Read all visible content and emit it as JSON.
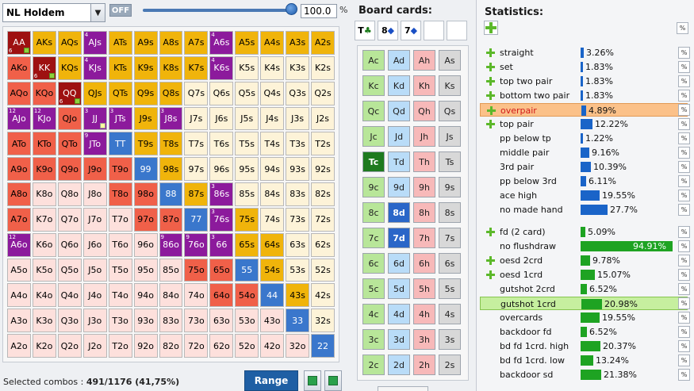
{
  "toolbar": {
    "game_select": "NL Holdem",
    "toggle_label": "OFF",
    "range_value": "100.0",
    "range_unit": "%"
  },
  "matrix": {
    "rows": [
      [
        "AA",
        "AKs",
        "AQs",
        "AJs",
        "ATs",
        "A9s",
        "A8s",
        "A7s",
        "A6s",
        "A5s",
        "A4s",
        "A3s",
        "A2s"
      ],
      [
        "AKo",
        "KK",
        "KQs",
        "KJs",
        "KTs",
        "K9s",
        "K8s",
        "K7s",
        "K6s",
        "K5s",
        "K4s",
        "K3s",
        "K2s"
      ],
      [
        "AQo",
        "KQo",
        "QQ",
        "QJs",
        "QTs",
        "Q9s",
        "Q8s",
        "Q7s",
        "Q6s",
        "Q5s",
        "Q4s",
        "Q3s",
        "Q2s"
      ],
      [
        "AJo",
        "KJo",
        "QJo",
        "JJ",
        "JTs",
        "J9s",
        "J8s",
        "J7s",
        "J6s",
        "J5s",
        "J4s",
        "J3s",
        "J2s"
      ],
      [
        "ATo",
        "KTo",
        "QTo",
        "JTo",
        "TT",
        "T9s",
        "T8s",
        "T7s",
        "T6s",
        "T5s",
        "T4s",
        "T3s",
        "T2s"
      ],
      [
        "A9o",
        "K9o",
        "Q9o",
        "J9o",
        "T9o",
        "99",
        "98s",
        "97s",
        "96s",
        "95s",
        "94s",
        "93s",
        "92s"
      ],
      [
        "A8o",
        "K8o",
        "Q8o",
        "J8o",
        "T8o",
        "98o",
        "88",
        "87s",
        "86s",
        "85s",
        "84s",
        "83s",
        "82s"
      ],
      [
        "A7o",
        "K7o",
        "Q7o",
        "J7o",
        "T7o",
        "97o",
        "87o",
        "77",
        "76s",
        "75s",
        "74s",
        "73s",
        "72s"
      ],
      [
        "A6o",
        "K6o",
        "Q6o",
        "J6o",
        "T6o",
        "96o",
        "86o",
        "76o",
        "66",
        "65s",
        "64s",
        "63s",
        "62s"
      ],
      [
        "A5o",
        "K5o",
        "Q5o",
        "J5o",
        "T5o",
        "95o",
        "85o",
        "75o",
        "65o",
        "55",
        "54s",
        "53s",
        "52s"
      ],
      [
        "A4o",
        "K4o",
        "Q4o",
        "J4o",
        "T4o",
        "94o",
        "84o",
        "74o",
        "64o",
        "54o",
        "44",
        "43s",
        "42s"
      ],
      [
        "A3o",
        "K3o",
        "Q3o",
        "J3o",
        "T3o",
        "93o",
        "83o",
        "73o",
        "63o",
        "53o",
        "43o",
        "33",
        "32s"
      ],
      [
        "A2o",
        "K2o",
        "Q2o",
        "J2o",
        "T2o",
        "92o",
        "82o",
        "72o",
        "62o",
        "52o",
        "42o",
        "32o",
        "22"
      ]
    ],
    "colors": [
      [
        "dr",
        "y",
        "y",
        "p",
        "y",
        "y",
        "y",
        "y",
        "p",
        "y",
        "y",
        "y",
        "y"
      ],
      [
        "r",
        "dr",
        "y",
        "p",
        "y",
        "y",
        "y",
        "y",
        "p",
        "l",
        "l",
        "l",
        "l"
      ],
      [
        "r",
        "r",
        "dr",
        "y",
        "y",
        "y",
        "y",
        "l",
        "l",
        "l",
        "l",
        "l",
        "l"
      ],
      [
        "p",
        "p",
        "r",
        "p",
        "p",
        "y",
        "p",
        "l",
        "l",
        "l",
        "l",
        "l",
        "l"
      ],
      [
        "r",
        "r",
        "r",
        "p",
        "b",
        "y",
        "y",
        "l",
        "l",
        "l",
        "l",
        "l",
        "l"
      ],
      [
        "r",
        "r",
        "r",
        "r",
        "r",
        "b",
        "y",
        "l",
        "l",
        "l",
        "l",
        "l",
        "l"
      ],
      [
        "r",
        "k",
        "k",
        "k",
        "r",
        "r",
        "b",
        "y",
        "p",
        "l",
        "l",
        "l",
        "l"
      ],
      [
        "r",
        "k",
        "k",
        "k",
        "k",
        "r",
        "r",
        "b",
        "p",
        "y",
        "l",
        "l",
        "l"
      ],
      [
        "p",
        "k",
        "k",
        "k",
        "k",
        "k",
        "p",
        "p",
        "p",
        "y",
        "y",
        "l",
        "l"
      ],
      [
        "k",
        "k",
        "k",
        "k",
        "k",
        "k",
        "k",
        "r",
        "r",
        "b",
        "y",
        "l",
        "l"
      ],
      [
        "k",
        "k",
        "k",
        "k",
        "k",
        "k",
        "k",
        "k",
        "r",
        "r",
        "b",
        "y",
        "l"
      ],
      [
        "k",
        "k",
        "k",
        "k",
        "k",
        "k",
        "k",
        "k",
        "k",
        "k",
        "k",
        "b",
        "l"
      ],
      [
        "k",
        "k",
        "k",
        "k",
        "k",
        "k",
        "k",
        "k",
        "k",
        "k",
        "k",
        "k",
        "b"
      ]
    ],
    "palette": {
      "dr": "#9e1111",
      "r": "#f06049",
      "y": "#f0b40b",
      "p": "#8c1a9c",
      "b": "#3a77cc",
      "l": "#fdf3d8",
      "k": "#fde0dc"
    },
    "badges": [
      {
        "cell": "AA",
        "sub": "6",
        "plus": true
      },
      {
        "cell": "KK",
        "sub": "6",
        "plus": true
      },
      {
        "cell": "QQ",
        "sub": "6",
        "plus": true
      },
      {
        "cell": "AJs",
        "sub": "4"
      },
      {
        "cell": "KJs",
        "sub": "4"
      },
      {
        "cell": "A6s",
        "sub": "4"
      },
      {
        "cell": "K6s",
        "sub": "4"
      },
      {
        "cell": "AJo",
        "sub": "12"
      },
      {
        "cell": "KJo",
        "sub": "12"
      },
      {
        "cell": "JJ",
        "sub": "3",
        "box": true
      },
      {
        "cell": "JTs",
        "sub": "3"
      },
      {
        "cell": "J8s",
        "sub": "3"
      },
      {
        "cell": "JTo",
        "sub": "9"
      },
      {
        "cell": "86s",
        "sub": "3"
      },
      {
        "cell": "76s",
        "sub": "3"
      },
      {
        "cell": "A6o",
        "sub": "12"
      },
      {
        "cell": "86o",
        "sub": "9"
      },
      {
        "cell": "76o",
        "sub": "9"
      },
      {
        "cell": "66",
        "sub": "3"
      }
    ]
  },
  "status": {
    "label": "Selected combos :",
    "value": "491/1176 (41,75%)"
  },
  "range_button": "Range",
  "board": {
    "title": "Board cards:",
    "slots": [
      {
        "rank": "T",
        "suit": "♣",
        "color": "#1a7a1a"
      },
      {
        "rank": "8",
        "suit": "◆",
        "color": "#1a4fc4"
      },
      {
        "rank": "7",
        "suit": "◆",
        "color": "#1a4fc4"
      },
      {
        "rank": "",
        "suit": "",
        "color": "#000"
      },
      {
        "rank": "",
        "suit": "",
        "color": "#000"
      }
    ],
    "ranks": [
      "A",
      "K",
      "Q",
      "J",
      "T",
      "9",
      "8",
      "7",
      "6",
      "5",
      "4",
      "3",
      "2"
    ],
    "suits": [
      "c",
      "d",
      "h",
      "s"
    ],
    "suit_colors": {
      "c": "#b8e699",
      "d": "#b9dcf8",
      "h": "#f7b9b9",
      "s": "#d8d8d8"
    },
    "selected": {
      "Tc": "#1e7a1e",
      "8d": "#2a66c8",
      "7d": "#2a66c8"
    }
  },
  "stats": {
    "title": "Statistics:",
    "pct_label": "%",
    "rows": [
      {
        "label": "straight",
        "value": "3.26%",
        "pct": 3.26,
        "plus": true
      },
      {
        "label": "set",
        "value": "1.83%",
        "pct": 1.83,
        "plus": true
      },
      {
        "label": "top two pair",
        "value": "1.83%",
        "pct": 1.83,
        "plus": true
      },
      {
        "label": "bottom two pair",
        "value": "1.83%",
        "pct": 1.83,
        "plus": true
      },
      {
        "label": "overpair",
        "value": "4.89%",
        "pct": 4.89,
        "plus": true,
        "highlight": "orange"
      },
      {
        "label": "top pair",
        "value": "12.22%",
        "pct": 12.22,
        "plus": true
      },
      {
        "label": "pp below tp",
        "value": "1.22%",
        "pct": 1.22
      },
      {
        "label": "middle pair",
        "value": "9.16%",
        "pct": 9.16
      },
      {
        "label": "3rd pair",
        "value": "10.39%",
        "pct": 10.39
      },
      {
        "label": "pp below 3rd",
        "value": "6.11%",
        "pct": 6.11
      },
      {
        "label": "ace high",
        "value": "19.55%",
        "pct": 19.55
      },
      {
        "label": "no made hand",
        "value": "27.7%",
        "pct": 27.7
      },
      {
        "label": "fd (2 card)",
        "value": "5.09%",
        "pct": 5.09,
        "plus": true,
        "green": true
      },
      {
        "label": "no flushdraw",
        "value": "94.91%",
        "pct": 94.91,
        "green": true
      },
      {
        "label": "oesd 2crd",
        "value": "9.78%",
        "pct": 9.78,
        "plus": true,
        "green": true
      },
      {
        "label": "oesd 1crd",
        "value": "15.07%",
        "pct": 15.07,
        "plus": true,
        "green": true
      },
      {
        "label": "gutshot 2crd",
        "value": "6.52%",
        "pct": 6.52,
        "green": true
      },
      {
        "label": "gutshot 1crd",
        "value": "20.98%",
        "pct": 20.98,
        "green": true,
        "highlight": "green"
      },
      {
        "label": "overcards",
        "value": "19.55%",
        "pct": 19.55,
        "green": true
      },
      {
        "label": "backdoor fd",
        "value": "6.52%",
        "pct": 6.52,
        "green": true
      },
      {
        "label": "bd fd 1crd. high",
        "value": "20.37%",
        "pct": 20.37,
        "green": true
      },
      {
        "label": "bd fd 1crd. low",
        "value": "13.24%",
        "pct": 13.24,
        "green": true
      },
      {
        "label": "backdoor sd",
        "value": "21.38%",
        "pct": 21.38,
        "green": true
      }
    ]
  }
}
